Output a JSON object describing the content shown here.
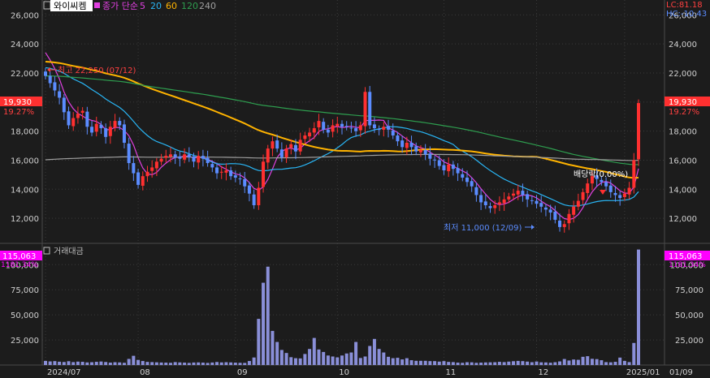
{
  "header": {
    "ticker": "와이씨켐",
    "ma_title": "종가 단순",
    "ma_periods": [
      {
        "label": "5",
        "color": "#e040e0"
      },
      {
        "label": "20",
        "color": "#29b6f6"
      },
      {
        "label": "60",
        "color": "#ffb300"
      },
      {
        "label": "120",
        "color": "#2e9e4f"
      },
      {
        "label": "240",
        "color": "#9e9e9e"
      }
    ],
    "lc_label": "LC:81.18",
    "hc_label": "HC:-10.43"
  },
  "colors": {
    "up": "#ff3030",
    "down": "#5b8cff",
    "volume": "#8a8fd8",
    "background": "#1c1c1c",
    "grid": "#3a3a3a",
    "text": "#d0d0d0",
    "magenta_badge": "#ff00ff"
  },
  "price_panel": {
    "current_price_label": "19,930",
    "change_label": "19.27%",
    "high_annotation": "최고 22,250 (07/12)",
    "low_annotation": "최저 11,000 (12/09)",
    "dividend_annotation": "배당락(0.00%)"
  },
  "volume_panel": {
    "title": "거래대금",
    "current_label": "115,063",
    "change_label": "1181.34%"
  },
  "chart_data": [
    {
      "type": "candlestick",
      "title": "와이씨켐",
      "y_ticks": [
        12000,
        14000,
        16000,
        18000,
        20000,
        22000,
        24000,
        26000
      ],
      "y_tick_labels": [
        "12,000",
        "14,000",
        "16,000",
        "18,000",
        "20,000",
        "22,000",
        "24,000",
        "26,000"
      ],
      "ylim": [
        10500,
        26800
      ],
      "x_tick_labels": [
        "2024/07",
        "08",
        "09",
        "10",
        "11",
        "12",
        "2025/01",
        "01/09"
      ],
      "x_tick_index": [
        0,
        20,
        41,
        63,
        86,
        106,
        125,
        138
      ],
      "closes": [
        21800,
        21300,
        20800,
        20300,
        19300,
        18400,
        18900,
        19200,
        19400,
        18300,
        17900,
        18500,
        18200,
        17600,
        18300,
        18700,
        18400,
        17200,
        15800,
        15100,
        14300,
        14900,
        15200,
        15500,
        15900,
        16100,
        16300,
        16400,
        16200,
        16100,
        16400,
        16200,
        15900,
        16300,
        16100,
        15800,
        15500,
        15100,
        15200,
        15300,
        14900,
        14800,
        14700,
        14200,
        13700,
        12900,
        14100,
        15900,
        16800,
        17300,
        16800,
        16200,
        16800,
        17100,
        16600,
        17400,
        17700,
        17900,
        18200,
        18700,
        18100,
        17900,
        18400,
        18500,
        18300,
        18300,
        18200,
        18000,
        18400,
        20700,
        18400,
        18200,
        18100,
        18300,
        18100,
        17700,
        17300,
        16900,
        17200,
        16900,
        16600,
        16700,
        16400,
        16100,
        16000,
        15600,
        15300,
        15700,
        15400,
        15100,
        14800,
        14500,
        14200,
        13600,
        13100,
        12900,
        12700,
        12900,
        13100,
        13300,
        13500,
        13700,
        13900,
        13600,
        13300,
        13200,
        13000,
        12800,
        12600,
        12400,
        11900,
        11400,
        11600,
        12300,
        12800,
        13200,
        13800,
        14400,
        14900,
        14700,
        14500,
        14200,
        13800,
        13600,
        13400,
        13700,
        14100,
        16000,
        19930
      ],
      "ma_series": [
        {
          "period": 5,
          "color": "#e040e0"
        },
        {
          "period": 20,
          "color": "#29b6f6"
        },
        {
          "period": 60,
          "color": "#ffb300"
        },
        {
          "period": 120,
          "color": "#2e9e4f"
        },
        {
          "period": 240,
          "color": "#9e9e9e"
        }
      ],
      "high": {
        "value": 22250,
        "date": "07/12"
      },
      "low": {
        "value": 11000,
        "date": "12/09"
      }
    },
    {
      "type": "bar",
      "title": "거래대금",
      "y_ticks": [
        25000,
        50000,
        75000,
        100000
      ],
      "y_tick_labels": [
        "25,000",
        "50,000",
        "75,000",
        "100,000"
      ],
      "ylim": [
        0,
        118000
      ],
      "values": [
        4100,
        3600,
        3900,
        3300,
        3000,
        3800,
        2900,
        3400,
        3200,
        2600,
        2800,
        3200,
        3500,
        3000,
        2400,
        2800,
        2600,
        2200,
        6100,
        9200,
        5100,
        4000,
        3100,
        2900,
        2700,
        2500,
        2400,
        2200,
        2900,
        2600,
        2400,
        2100,
        2500,
        2600,
        2400,
        2100,
        2500,
        3000,
        2600,
        2800,
        2600,
        2400,
        2200,
        2100,
        4000,
        7500,
        46000,
        82000,
        98000,
        34000,
        23000,
        15000,
        12000,
        7800,
        6800,
        6600,
        11000,
        16000,
        27000,
        15500,
        13000,
        9500,
        8500,
        7600,
        9500,
        11500,
        12500,
        23000,
        7000,
        8500,
        19000,
        26000,
        16000,
        12500,
        8200,
        6800,
        7200,
        5600,
        6800,
        4800,
        4200,
        4200,
        4200,
        3900,
        3900,
        3400,
        3900,
        3100,
        2900,
        2400,
        2200,
        2800,
        2700,
        2200,
        2400,
        2600,
        2700,
        2800,
        3200,
        2900,
        3400,
        3800,
        4100,
        3900,
        3400,
        2800,
        3500,
        2700,
        2600,
        2300,
        2800,
        3600,
        6000,
        4500,
        5500,
        5200,
        8200,
        8800,
        6200,
        5900,
        4800,
        2900,
        2700,
        3200,
        7400,
        4100,
        2900,
        22000,
        115063
      ]
    }
  ]
}
